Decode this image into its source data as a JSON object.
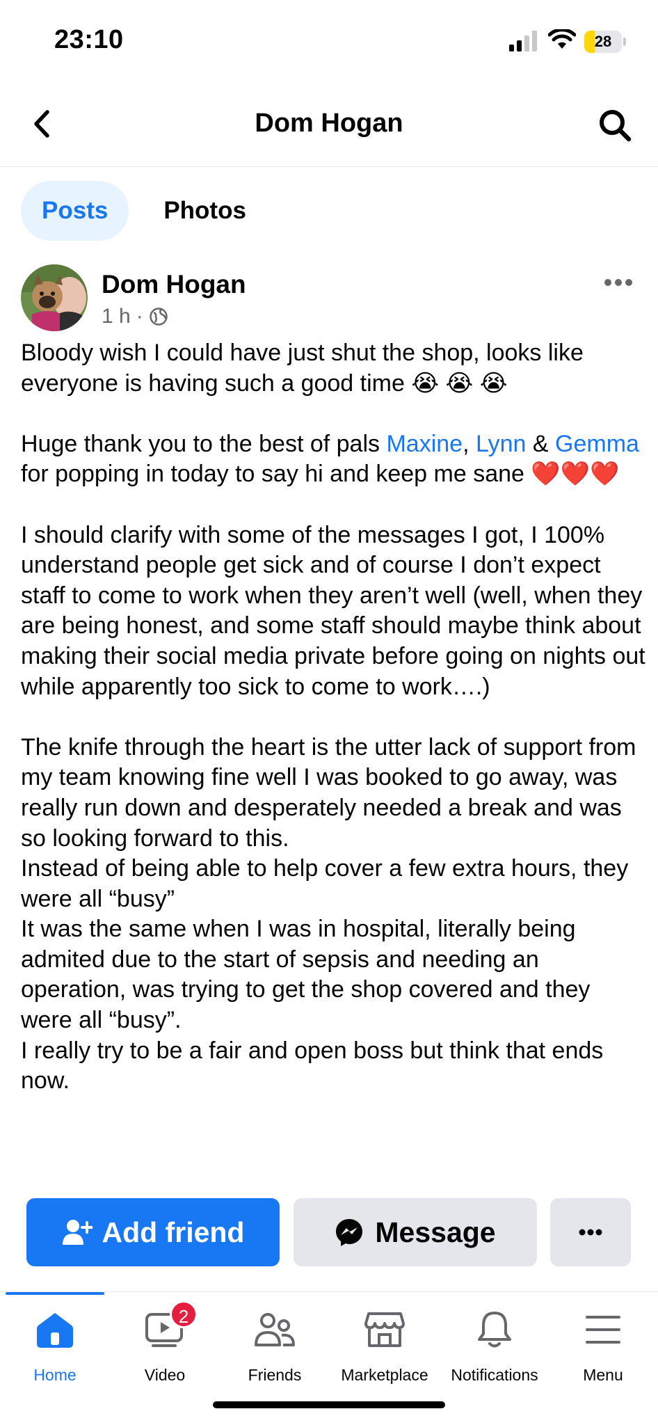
{
  "status_bar": {
    "time": "23:10",
    "battery_level": "28",
    "battery_fraction": 0.28
  },
  "header": {
    "title": "Dom Hogan",
    "back_icon": "chevron-left-icon",
    "search_icon": "search-icon"
  },
  "tabs": [
    {
      "label": "Posts",
      "active": true
    },
    {
      "label": "Photos",
      "active": false
    }
  ],
  "post": {
    "author": "Dom Hogan",
    "time": "1 h",
    "separator": "·",
    "audience_icon": "globe-icon",
    "paragraph1": {
      "text": "Bloody wish I could have just shut the shop, looks like everyone is having such a good time",
      "emoji": "😭 😭 😭"
    },
    "paragraph2": {
      "prefix": "Huge thank you to the best of pals ",
      "mention1": "Maxine",
      "comma": ", ",
      "mention2": "Lynn",
      "amp": " & ",
      "mention3": "Gemma",
      "suffix": " for popping in today to say hi and keep me sane",
      "emoji": "❤️❤️❤️"
    },
    "paragraph3": "I should clarify with some of the messages I got, I 100% understand people get sick and of course I don’t expect staff to come to work when they aren’t well (well, when they are being honest, and some staff should maybe think about making their social media private before going on nights out while apparently too sick to come to work….)",
    "paragraph4_lines": [
      "The knife through the heart is the utter lack of support from my team knowing fine well I was booked to go away, was really run down and desperately needed a break and was so looking forward to this.",
      "Instead of being able to help cover a few extra hours, they were all “busy”",
      "It was the same when I was in hospital, literally being admited due to the start of sepsis and needing an operation, was trying to get the shop covered and they were all “busy”.",
      "I really try to be a fair and open boss but think that ends now."
    ]
  },
  "actions": {
    "add_friend": "Add friend",
    "message": "Message"
  },
  "bottom_nav": [
    {
      "label": "Home",
      "icon": "home-icon",
      "active": true
    },
    {
      "label": "Video",
      "icon": "video-icon",
      "badge": "2"
    },
    {
      "label": "Friends",
      "icon": "friends-icon"
    },
    {
      "label": "Marketplace",
      "icon": "marketplace-icon"
    },
    {
      "label": "Notifications",
      "icon": "bell-icon"
    },
    {
      "label": "Menu",
      "icon": "menu-icon"
    }
  ],
  "colors": {
    "brand_blue": "#1877f2",
    "tab_active_bg": "#e7f3ff",
    "button_gray": "#e4e6eb",
    "badge_red": "#e41e3f",
    "battery_yellow": "#ffd60a"
  }
}
